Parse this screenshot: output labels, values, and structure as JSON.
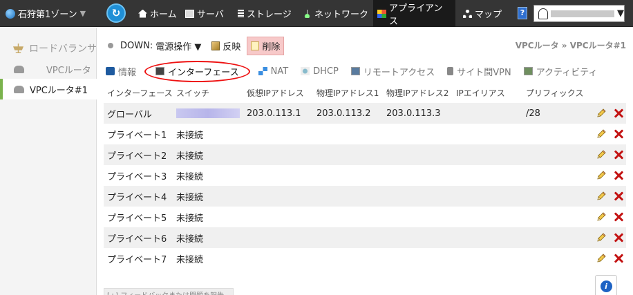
{
  "topbar": {
    "zone_label": "石狩第1ゾーン",
    "zone_caret": "▼",
    "nav": [
      {
        "label": "ホーム",
        "icon": "home-icon"
      },
      {
        "label": "サーバ",
        "icon": "server-icon"
      },
      {
        "label": "ストレージ",
        "icon": "storage-icon"
      },
      {
        "label": "ネットワーク",
        "icon": "network-icon"
      },
      {
        "label": "アプライアンス",
        "icon": "appliance-icon",
        "active": true
      },
      {
        "label": "マップ",
        "icon": "map-icon"
      }
    ],
    "help_glyph": "?",
    "account_caret": "▼"
  },
  "sidebar": {
    "items": [
      {
        "label": "ロードバランサ",
        "icon": "load-balancer-icon"
      },
      {
        "label": "VPCルータ",
        "icon": "cloud-icon"
      },
      {
        "label": "VPCルータ#1",
        "icon": "cloud-icon",
        "selected": true
      }
    ]
  },
  "toolbar": {
    "status": "DOWN:",
    "power_menu": "電源操作 ▼",
    "reflect": "反映",
    "delete": "削除"
  },
  "breadcrumb": "VPCルータ » VPCルータ#1",
  "tabs": [
    {
      "label": "情報",
      "icon": "info-icon"
    },
    {
      "label": "インターフェース",
      "icon": "monitor-icon",
      "active": true
    },
    {
      "label": "NAT",
      "icon": "nat-icon"
    },
    {
      "label": "DHCP",
      "icon": "dhcp-icon"
    },
    {
      "label": "リモートアクセス",
      "icon": "remote-access-icon"
    },
    {
      "label": "サイト間VPN",
      "icon": "site-vpn-icon"
    },
    {
      "label": "アクティビティ",
      "icon": "activity-icon"
    }
  ],
  "table": {
    "columns": [
      "インターフェース",
      "スイッチ",
      "仮想IPアドレス",
      "物理IPアドレス1",
      "物理IPアドレス2",
      "IPエイリアス",
      "プリフィックス"
    ],
    "rows": [
      {
        "iface": "グローバル",
        "switch": "",
        "vip": "203.0.113.1",
        "ip1": "203.0.113.2",
        "ip2": "203.0.113.3",
        "alias": "",
        "prefix": "/28"
      },
      {
        "iface": "プライベート1",
        "switch": "未接続",
        "vip": "",
        "ip1": "",
        "ip2": "",
        "alias": "",
        "prefix": ""
      },
      {
        "iface": "プライベート2",
        "switch": "未接続",
        "vip": "",
        "ip1": "",
        "ip2": "",
        "alias": "",
        "prefix": ""
      },
      {
        "iface": "プライベート3",
        "switch": "未接続",
        "vip": "",
        "ip1": "",
        "ip2": "",
        "alias": "",
        "prefix": ""
      },
      {
        "iface": "プライベート4",
        "switch": "未接続",
        "vip": "",
        "ip1": "",
        "ip2": "",
        "alias": "",
        "prefix": ""
      },
      {
        "iface": "プライベート5",
        "switch": "未接続",
        "vip": "",
        "ip1": "",
        "ip2": "",
        "alias": "",
        "prefix": ""
      },
      {
        "iface": "プライベート6",
        "switch": "未接続",
        "vip": "",
        "ip1": "",
        "ip2": "",
        "alias": "",
        "prefix": ""
      },
      {
        "iface": "プライベート7",
        "switch": "未接続",
        "vip": "",
        "ip1": "",
        "ip2": "",
        "alias": "",
        "prefix": ""
      }
    ]
  },
  "feedback": "[+] フィードバックまたは問題を報告",
  "info_glyph": "i",
  "colors": {
    "topbar_bg": "#353535",
    "accent_green": "#7bb34d",
    "delete_bg": "#f7c9c9",
    "tab_highlight": "#e11111",
    "delete_icon": "#c31313"
  }
}
